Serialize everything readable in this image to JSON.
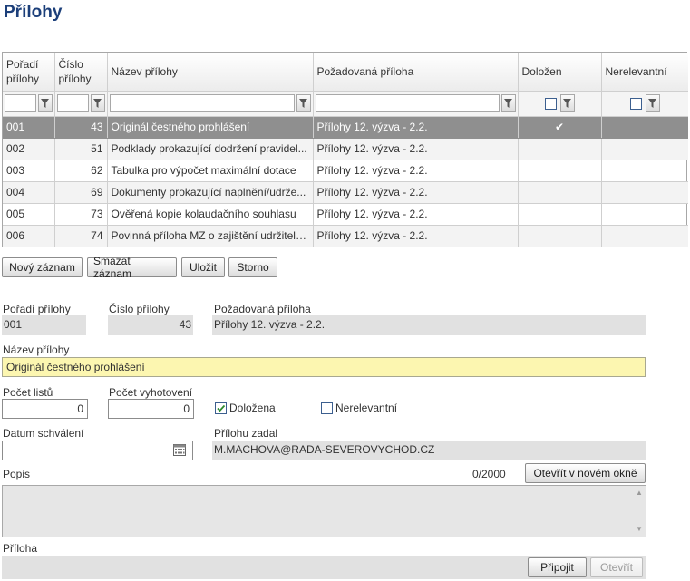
{
  "page": {
    "title": "Přílohy"
  },
  "grid": {
    "columns": [
      {
        "label_line1": "Pořadí",
        "label_line2": "přílohy"
      },
      {
        "label_line1": "Číslo",
        "label_line2": "přílohy"
      },
      {
        "label_line1": "Název přílohy",
        "label_line2": ""
      },
      {
        "label_line1": "Požadovaná příloha",
        "label_line2": ""
      },
      {
        "label_line1": "Doložen",
        "label_line2": ""
      },
      {
        "label_line1": "Nerelevantní",
        "label_line2": ""
      }
    ],
    "rows": [
      {
        "poradi": "001",
        "cislo": "43",
        "nazev": "Originál čestného prohlášení",
        "pozadovana": "Přílohy 12. výzva - 2.2.",
        "dolozen": true,
        "nerelevantni": false
      },
      {
        "poradi": "002",
        "cislo": "51",
        "nazev": "Podklady prokazující dodržení pravidel...",
        "pozadovana": "Přílohy 12. výzva - 2.2.",
        "dolozen": false,
        "nerelevantni": false
      },
      {
        "poradi": "003",
        "cislo": "62",
        "nazev": "Tabulka pro výpočet maximální dotace",
        "pozadovana": "Přílohy 12. výzva - 2.2.",
        "dolozen": false,
        "nerelevantni": false
      },
      {
        "poradi": "004",
        "cislo": "69",
        "nazev": "Dokumenty prokazující naplnění/udrže...",
        "pozadovana": "Přílohy 12. výzva - 2.2.",
        "dolozen": false,
        "nerelevantni": false
      },
      {
        "poradi": "005",
        "cislo": "73",
        "nazev": "Ověřená kopie kolaudačního souhlasu",
        "pozadovana": "Přílohy 12. výzva - 2.2.",
        "dolozen": false,
        "nerelevantni": false
      },
      {
        "poradi": "006",
        "cislo": "74",
        "nazev": "Povinná příloha MZ o zajištění udržiteln...",
        "pozadovana": "Přílohy 12. výzva - 2.2.",
        "dolozen": false,
        "nerelevantni": false
      }
    ],
    "check_glyph": "✔"
  },
  "toolbar": {
    "new_label": "Nový záznam",
    "delete_label": "Smazat záznam",
    "save_label": "Uložit",
    "cancel_label": "Storno"
  },
  "detail": {
    "poradi_label": "Pořadí přílohy",
    "poradi_value": "001",
    "cislo_label": "Číslo přílohy",
    "cislo_value": "43",
    "pozadovana_label": "Požadovaná příloha",
    "pozadovana_value": "Přílohy 12. výzva - 2.2.",
    "nazev_label": "Název přílohy",
    "nazev_value": "Originál čestného prohlášení",
    "pocet_listu_label": "Počet listů",
    "pocet_listu_value": "0",
    "pocet_vyhotoveni_label": "Počet vyhotovení",
    "pocet_vyhotoveni_value": "0",
    "dolozena_label": "Doložena",
    "dolozena_checked": true,
    "nerelevantni_label": "Nerelevantní",
    "nerelevantni_checked": false,
    "datum_label": "Datum schválení",
    "datum_value": "",
    "zadal_label": "Přílohu zadal",
    "zadal_value": "M.MACHOVA@RADA-SEVEROVYCHOD.CZ",
    "popis_label": "Popis",
    "popis_counter": "0/2000",
    "open_new_window_label": "Otevřít v novém okně",
    "priloha_label": "Příloha",
    "attach_label": "Připojit",
    "open_label": "Otevřít"
  },
  "colors": {
    "title": "#1c3f7a",
    "selected_row": "#8f8f8f",
    "highlight_field": "#fcf6b0",
    "check": "#2e8b2e"
  }
}
